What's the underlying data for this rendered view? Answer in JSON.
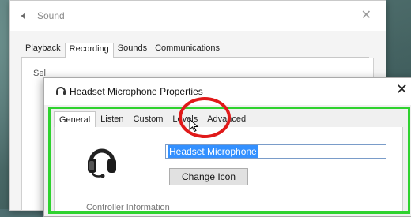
{
  "sound_window": {
    "title": "Sound",
    "tabs": [
      "Playback",
      "Recording",
      "Sounds",
      "Communications"
    ],
    "active_tab": "Recording",
    "body_text": "Sel"
  },
  "props_dialog": {
    "title": "Headset Microphone Properties",
    "tabs": [
      "General",
      "Listen",
      "Custom",
      "Levels",
      "Advanced"
    ],
    "active_tab": "General",
    "device_name": "Headset Microphone",
    "change_icon_label": "Change Icon",
    "controller_info": "Controller Information"
  },
  "annotations": {
    "highlight_color": "#2fd22f",
    "circle_color": "#e01919"
  },
  "icons": {
    "sound": "speaker-icon",
    "headset": "headset-icon",
    "cursor": "mouse-pointer-icon"
  }
}
